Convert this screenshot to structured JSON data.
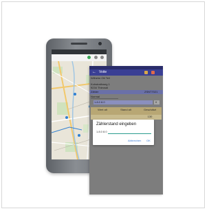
{
  "tablet": {
    "app_title": "Voite",
    "customer_name": "Wilhelm Ott Tell",
    "street": "Kuhstrathweg 1",
    "city": "9234 Thieosdi",
    "meter_label": "Zähler",
    "meter_number": "ZSNT7021",
    "meter_type": "Normal",
    "value_row_label": "1.8.0 8.0",
    "value_button": "0",
    "columns": [
      {
        "label": "Wert alt"
      },
      {
        "label": "Stand alt"
      },
      {
        "label": "Geschätzt"
      }
    ],
    "estimated_value": "130",
    "dialog": {
      "title": "Zählerstand eingeben",
      "field_label": "1.8.0 8.0",
      "field_value": "",
      "cancel_label": "Abbrechen",
      "ok_label": "OK"
    }
  },
  "colors": {
    "appbar": "#3a3f94",
    "statusbar": "#2a2d6b",
    "highlight": "#6a70a8",
    "table_header": "#b8a774",
    "dialog_accent": "#2a9d8f"
  },
  "icons": [
    "back-arrow-icon",
    "settings-icon",
    "info-icon",
    "map-marker-icon"
  ]
}
